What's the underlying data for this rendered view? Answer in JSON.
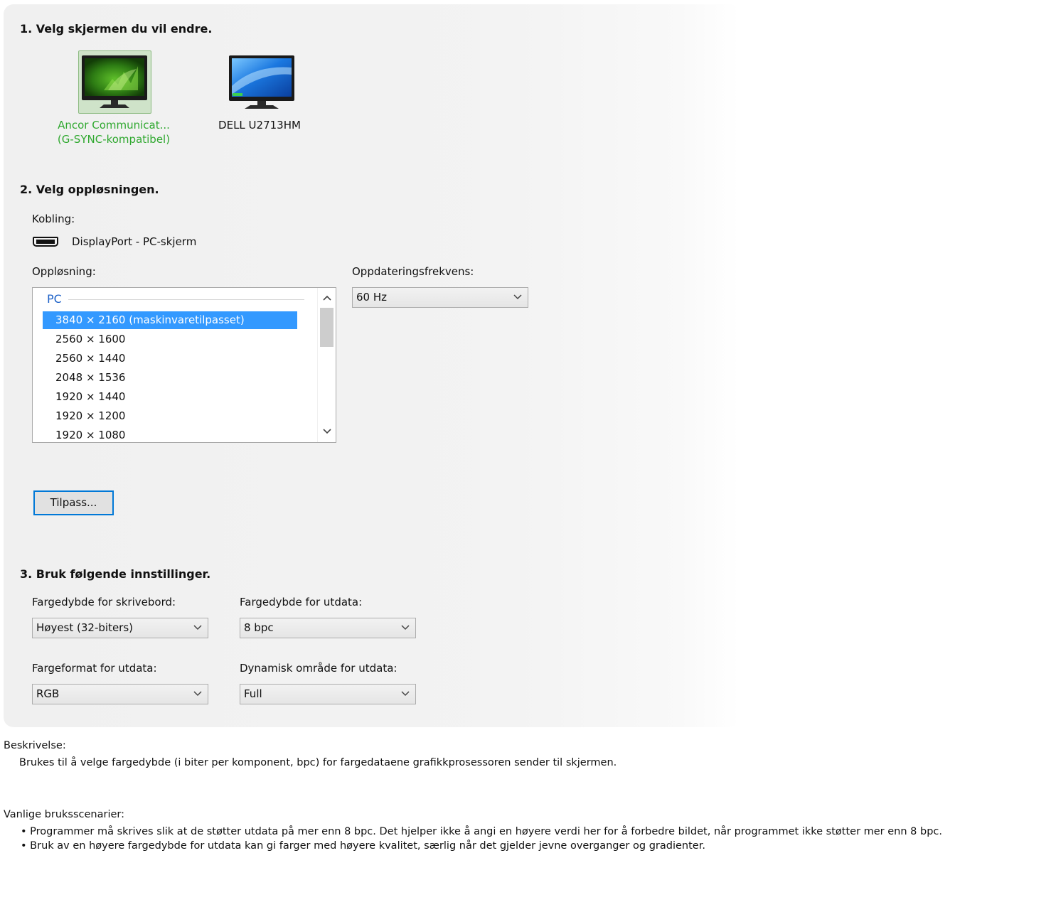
{
  "section1": {
    "heading": "1. Velg skjermen du vil endre.",
    "monitors": [
      {
        "line1": "Ancor Communicat...",
        "line2": "(G-SYNC-kompatibel)",
        "selected": true,
        "icon": "nvidia-monitor-icon"
      },
      {
        "line1": "DELL U2713HM",
        "line2": "",
        "selected": false,
        "icon": "windows-monitor-icon"
      }
    ]
  },
  "section2": {
    "heading": "2. Velg oppløsningen.",
    "connection_label": "Kobling:",
    "connection_value": "DisplayPort - PC-skjerm",
    "connection_icon": "displayport-icon",
    "resolution_label": "Oppløsning:",
    "resolution_group": "PC",
    "resolutions": [
      "3840 × 2160 (maskinvaretilpasset)",
      "2560 × 1600",
      "2560 × 1440",
      "2048 × 1536",
      "1920 × 1440",
      "1920 × 1200",
      "1920 × 1080"
    ],
    "selected_resolution_index": 0,
    "refresh_label": "Oppdateringsfrekvens:",
    "refresh_value": "60 Hz",
    "customize_button": "Tilpass..."
  },
  "section3": {
    "heading": "3. Bruk følgende innstillinger.",
    "desktop_depth_label": "Fargedybde for skrivebord:",
    "desktop_depth_value": "Høyest (32-biters)",
    "output_depth_label": "Fargedybde for utdata:",
    "output_depth_value": "8 bpc",
    "output_format_label": "Fargeformat for utdata:",
    "output_format_value": "RGB",
    "dynamic_range_label": "Dynamisk område for utdata:",
    "dynamic_range_value": "Full"
  },
  "description": {
    "label": "Beskrivelse:",
    "text": "Brukes til å velge fargedybde (i biter per komponent, bpc) for fargedataene grafikkprosessoren sender til skjermen."
  },
  "usage": {
    "label": "Vanlige bruksscenarier:",
    "bullets": [
      "Programmer må skrives slik at de støtter utdata på mer enn 8 bpc. Det hjelper ikke å angi en høyere verdi her for å forbedre bildet, når programmet ikke støtter mer enn 8 bpc.",
      "Bruk av en høyere fargedybde for utdata kan gi farger med høyere kvalitet, særlig når det gjelder jevne overganger og gradienter."
    ]
  },
  "colors": {
    "accent_green": "#2fa82f",
    "selection_blue": "#3399ff",
    "focus_blue": "#0078d7",
    "group_blue": "#1e62c8"
  }
}
